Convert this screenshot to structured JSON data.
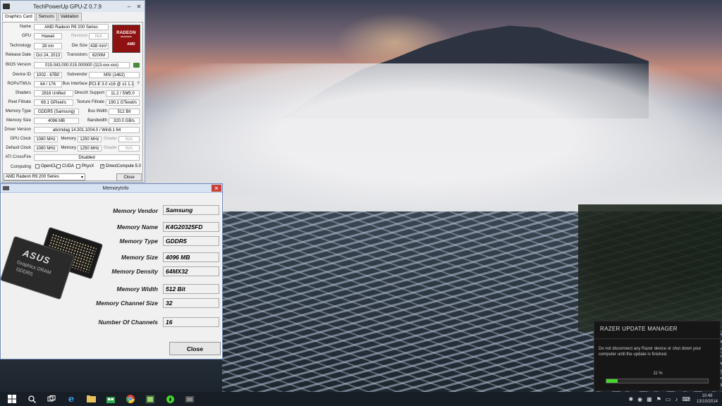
{
  "gpuz": {
    "title": "TechPowerUp GPU-Z 0.7.9",
    "tabs": [
      "Graphics Card",
      "Sensors",
      "Validation"
    ],
    "name": "AMD Radeon R9 200 Series",
    "gpu": "Hawaii",
    "revision": "N/A",
    "technology": "28 nm",
    "die_size": "438 mm²",
    "release_date": "Oct 24, 2013",
    "transistors": "6200M",
    "bios_version": "015.043.000.015.000000 (113-xxx-xxx)",
    "device_id": "1002 - 67B0",
    "subvendor": "MSI (1462)",
    "rops_tmus": "64 / 176",
    "bus_interface": "PCI-E 3.0 x16 @ x1 1.1",
    "shaders": "2816 Unified",
    "directx_support": "11.2 / SM5.0",
    "pixel_fillrate": "69.1 GPixel/s",
    "texture_fillrate": "190.1 GTexel/s",
    "memory_type": "GDDR5 (Samsung)",
    "bus_width": "512 Bit",
    "memory_size": "4096 MB",
    "bandwidth": "320.0 GB/s",
    "driver_version": "aticmdag 14.301.1004.0 / Win8.1 64",
    "gpu_clock": "1080 MHz",
    "memory_clock": "1250 MHz",
    "shader_clock": "N/A",
    "default_gpu_clock": "1080 MHz",
    "default_memory_clock": "1250 MHz",
    "default_shader_clock": "N/A",
    "crossfire": "Disabled",
    "labels": {
      "name": "Name",
      "gpu": "GPU",
      "revision": "Revision",
      "technology": "Technology",
      "die_size": "Die Size",
      "release_date": "Release Date",
      "transistors": "Transistors",
      "bios": "BIOS Version",
      "device_id": "Device ID",
      "subvendor": "Subvendor",
      "rops": "ROPs/TMUs",
      "bus_interface": "Bus Interface",
      "shaders": "Shaders",
      "directx": "DirectX Support",
      "pixel": "Pixel Fillrate",
      "texture": "Texture Fillrate",
      "memory_type": "Memory Type",
      "bus_width": "Bus Width",
      "memory_size": "Memory Size",
      "bandwidth": "Bandwidth",
      "driver": "Driver Version",
      "gpu_clock": "GPU Clock",
      "memory": "Memory",
      "shader": "Shader",
      "default_clock": "Default Clock",
      "crossfire": "ATI CrossFire",
      "computing": "Computing"
    },
    "computing": [
      {
        "label": "OpenCL",
        "checked": false
      },
      {
        "label": "CUDA",
        "checked": false
      },
      {
        "label": "PhysX",
        "checked": false
      },
      {
        "label": "DirectCompute 5.0",
        "checked": true
      }
    ],
    "card_select": "AMD Radeon R9 200 Series",
    "close_label": "Close",
    "logo": {
      "l1": "RADEON",
      "l2": "GRAPHICS",
      "l3": "AMD"
    }
  },
  "meminfo": {
    "title": "MemoryInfo",
    "fields": [
      {
        "label": "Memory Vendor",
        "value": "Samsung"
      },
      {
        "label": "Memory Name",
        "value": "K4G20325FD"
      },
      {
        "label": "Memory Type",
        "value": "GDDR5"
      },
      {
        "label": "Memory Size",
        "value": "4096 MB"
      },
      {
        "label": "Memory Density",
        "value": "64MX32"
      },
      {
        "label": "Memory Width",
        "value": "512 Bit"
      },
      {
        "label": "Memory Channel Size",
        "value": "32"
      },
      {
        "label": "Number Of Channels",
        "value": "16"
      }
    ],
    "close_label": "Close",
    "chip": {
      "brand": "ASUS",
      "line1": "Graphics DRAM",
      "line2": "GDDR5"
    }
  },
  "razer": {
    "title": "RAZER UPDATE MANAGER",
    "message": "Do not disconnect any Razer device or shut down your computer until the update is finished.",
    "progress_label": "11 %",
    "progress": 0.11,
    "accent": "#44d62c"
  },
  "taskbar": {
    "time": "10:48",
    "date": "13/10/2014"
  }
}
